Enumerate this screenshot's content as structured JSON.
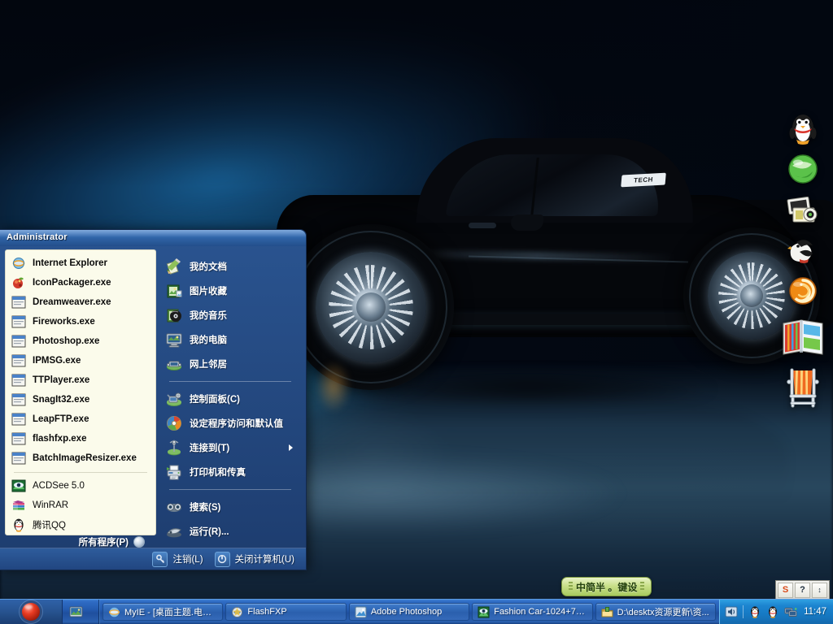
{
  "desktop": {
    "wallpaper_name": "black-sports-car-wallpaper",
    "dock_icons": [
      {
        "name": "qq-penguin-icon",
        "label": "QQ"
      },
      {
        "name": "green-orb-icon",
        "label": "Media"
      },
      {
        "name": "photo-stack-icon",
        "label": "Photos"
      },
      {
        "name": "bird-icon",
        "label": "Bird"
      },
      {
        "name": "orange-spiral-icon",
        "label": "Spiral"
      },
      {
        "name": "book-icon",
        "label": "Books"
      },
      {
        "name": "deck-chair-icon",
        "label": "Chair"
      }
    ]
  },
  "start_menu": {
    "user_name": "Administrator",
    "pinned_items": [
      {
        "label": "Internet Explorer",
        "icon": "internet-explorer-icon"
      },
      {
        "label": "IconPackager.exe",
        "icon": "iconpackager-icon"
      },
      {
        "label": "Dreamweaver.exe",
        "icon": "generic-window-icon"
      },
      {
        "label": "Fireworks.exe",
        "icon": "generic-window-icon"
      },
      {
        "label": "Photoshop.exe",
        "icon": "generic-window-icon"
      },
      {
        "label": "IPMSG.exe",
        "icon": "generic-window-icon"
      },
      {
        "label": "TTPlayer.exe",
        "icon": "generic-window-icon"
      },
      {
        "label": "SnagIt32.exe",
        "icon": "generic-window-icon"
      },
      {
        "label": "LeapFTP.exe",
        "icon": "generic-window-icon"
      },
      {
        "label": "flashfxp.exe",
        "icon": "generic-window-icon"
      },
      {
        "label": "BatchImageResizer.exe",
        "icon": "generic-window-icon"
      }
    ],
    "recent_items": [
      {
        "label": "ACDSee 5.0",
        "icon": "acdsee-icon"
      },
      {
        "label": "WinRAR",
        "icon": "winrar-icon"
      },
      {
        "label": "腾讯QQ",
        "icon": "qq-penguin-icon"
      }
    ],
    "all_programs_label": "所有程序(P)",
    "right_items_top": [
      {
        "label": "我的文档",
        "icon": "my-documents-icon"
      },
      {
        "label": "图片收藏",
        "icon": "my-pictures-icon"
      },
      {
        "label": "我的音乐",
        "icon": "my-music-icon"
      },
      {
        "label": "我的电脑",
        "icon": "my-computer-icon"
      },
      {
        "label": "网上邻居",
        "icon": "network-places-icon"
      }
    ],
    "right_items_mid": [
      {
        "label": "控制面板(C)",
        "icon": "control-panel-icon",
        "submenu": false
      },
      {
        "label": "设定程序访问和默认值",
        "icon": "set-program-access-icon",
        "submenu": false
      },
      {
        "label": "连接到(T)",
        "icon": "connect-to-icon",
        "submenu": true
      },
      {
        "label": "打印机和传真",
        "icon": "printers-and-faxes-icon",
        "submenu": false
      }
    ],
    "right_items_bottom": [
      {
        "label": "搜索(S)",
        "icon": "search-icon",
        "submenu": false
      },
      {
        "label": "运行(R)...",
        "icon": "run-icon",
        "submenu": false
      }
    ],
    "logoff_label": "注销(L)",
    "shutdown_label": "关闭计算机(U)"
  },
  "ime_bar": {
    "text": "中简半 。键设"
  },
  "taskbar": {
    "start_label": "",
    "quick_launch": [
      {
        "name": "show-desktop-icon",
        "label": "Show Desktop"
      }
    ],
    "tasks": [
      {
        "label": "MyIE - [桌面主题.电脑...",
        "icon": "myie-icon"
      },
      {
        "label": "FlashFXP",
        "icon": "flashfxp-icon"
      },
      {
        "label": "Adobe Photoshop",
        "icon": "photoshop-icon"
      },
      {
        "label": "Fashion Car-1024+76...",
        "icon": "acdsee-icon"
      },
      {
        "label": "D:\\desktx资源更新\\资...",
        "icon": "folder-icon"
      }
    ],
    "tray": [
      {
        "name": "volume-icon",
        "label": "Volume"
      },
      {
        "name": "qq-penguin-icon",
        "label": "QQ"
      },
      {
        "name": "qq-penguin-icon-2",
        "label": "QQ 2"
      },
      {
        "name": "network-icon",
        "label": "Network"
      }
    ],
    "clock": "11:47"
  },
  "mini_tray": [
    {
      "name": "sogou-icon",
      "label": "S"
    },
    {
      "name": "help-icon",
      "label": "?"
    },
    {
      "name": "spinner-icon",
      "label": "↕"
    }
  ],
  "colors": {
    "taskbar_blue": "#245bb0",
    "start_menu_blue": "#2a5490",
    "menu_panel_cream": "#fbfbeb",
    "accent_orb_red": "#e83b22",
    "ime_green": "#c9e08a"
  }
}
